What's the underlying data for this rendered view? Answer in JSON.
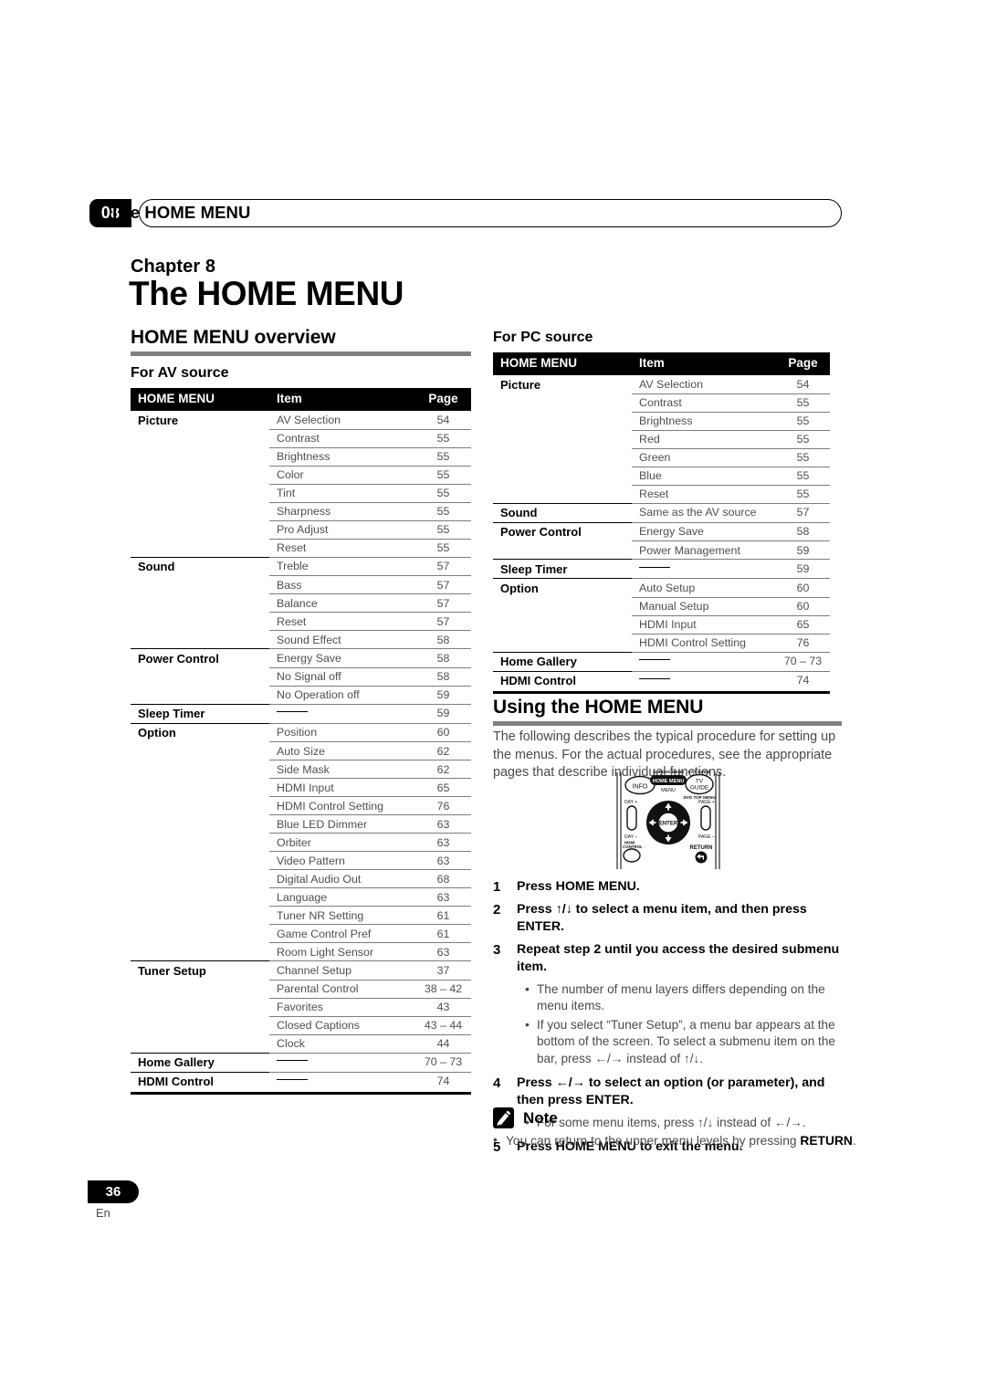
{
  "header": {
    "chapter_number": "08",
    "running_title": "The HOME MENU"
  },
  "chapter": {
    "label": "Chapter 8",
    "title": "The HOME MENU"
  },
  "sections": {
    "overview_heading": "HOME MENU overview",
    "av_source_heading": "For AV source",
    "pc_source_heading": "For PC source",
    "using_heading": "Using the HOME MENU"
  },
  "table_columns": {
    "menu": "HOME MENU",
    "item": "Item",
    "page": "Page"
  },
  "av_table": [
    {
      "menu": "Picture",
      "rows": [
        {
          "item": "AV Selection",
          "page": "54"
        },
        {
          "item": "Contrast",
          "page": "55"
        },
        {
          "item": "Brightness",
          "page": "55"
        },
        {
          "item": "Color",
          "page": "55"
        },
        {
          "item": "Tint",
          "page": "55"
        },
        {
          "item": "Sharpness",
          "page": "55"
        },
        {
          "item": "Pro Adjust",
          "page": "55"
        },
        {
          "item": "Reset",
          "page": "55"
        }
      ]
    },
    {
      "menu": "Sound",
      "rows": [
        {
          "item": "Treble",
          "page": "57"
        },
        {
          "item": "Bass",
          "page": "57"
        },
        {
          "item": "Balance",
          "page": "57"
        },
        {
          "item": "Reset",
          "page": "57"
        },
        {
          "item": "Sound Effect",
          "page": "58"
        }
      ]
    },
    {
      "menu": "Power Control",
      "rows": [
        {
          "item": "Energy Save",
          "page": "58"
        },
        {
          "item": "No Signal off",
          "page": "58"
        },
        {
          "item": "No Operation off",
          "page": "59"
        }
      ]
    },
    {
      "menu": "Sleep Timer",
      "rows": [
        {
          "item": "",
          "dash": true,
          "page": "59"
        }
      ]
    },
    {
      "menu": "Option",
      "rows": [
        {
          "item": "Position",
          "page": "60"
        },
        {
          "item": "Auto Size",
          "page": "62"
        },
        {
          "item": "Side Mask",
          "page": "62"
        },
        {
          "item": "HDMI Input",
          "page": "65"
        },
        {
          "item": "HDMI Control Setting",
          "page": "76"
        },
        {
          "item": "Blue LED Dimmer",
          "page": "63"
        },
        {
          "item": "Orbiter",
          "page": "63"
        },
        {
          "item": "Video Pattern",
          "page": "63"
        },
        {
          "item": "Digital Audio Out",
          "page": "68"
        },
        {
          "item": "Language",
          "page": "63"
        },
        {
          "item": "Tuner NR Setting",
          "page": "61"
        },
        {
          "item": "Game Control Pref",
          "page": "61"
        },
        {
          "item": "Room Light Sensor",
          "page": "63"
        }
      ]
    },
    {
      "menu": "Tuner Setup",
      "rows": [
        {
          "item": "Channel Setup",
          "page": "37"
        },
        {
          "item": "Parental Control",
          "page": "38 – 42"
        },
        {
          "item": "Favorites",
          "page": "43"
        },
        {
          "item": "Closed Captions",
          "page": "43 – 44"
        },
        {
          "item": "Clock",
          "page": "44"
        }
      ]
    },
    {
      "menu": "Home Gallery",
      "rows": [
        {
          "item": "",
          "dash": true,
          "page": "70 – 73"
        }
      ]
    },
    {
      "menu": "HDMI Control",
      "rows": [
        {
          "item": "",
          "dash": true,
          "page": "74"
        }
      ]
    }
  ],
  "pc_table": [
    {
      "menu": "Picture",
      "rows": [
        {
          "item": "AV Selection",
          "page": "54"
        },
        {
          "item": "Contrast",
          "page": "55"
        },
        {
          "item": "Brightness",
          "page": "55"
        },
        {
          "item": "Red",
          "page": "55"
        },
        {
          "item": "Green",
          "page": "55"
        },
        {
          "item": "Blue",
          "page": "55"
        },
        {
          "item": "Reset",
          "page": "55"
        }
      ]
    },
    {
      "menu": "Sound",
      "rows": [
        {
          "item": "Same as the AV source",
          "page": "57"
        }
      ]
    },
    {
      "menu": "Power Control",
      "rows": [
        {
          "item": "Energy Save",
          "page": "58"
        },
        {
          "item": "Power Management",
          "page": "59"
        }
      ]
    },
    {
      "menu": "Sleep Timer",
      "rows": [
        {
          "item": "",
          "dash": true,
          "page": "59"
        }
      ]
    },
    {
      "menu": "Option",
      "rows": [
        {
          "item": "Auto Setup",
          "page": "60"
        },
        {
          "item": "Manual Setup",
          "page": "60"
        },
        {
          "item": "HDMI Input",
          "page": "65"
        },
        {
          "item": "HDMI Control Setting",
          "page": "76"
        }
      ]
    },
    {
      "menu": "Home Gallery",
      "rows": [
        {
          "item": "",
          "dash": true,
          "page": "70 – 73"
        }
      ]
    },
    {
      "menu": "HDMI Control",
      "rows": [
        {
          "item": "",
          "dash": true,
          "page": "74"
        }
      ]
    }
  ],
  "using": {
    "intro": "The following describes the typical procedure for setting up the menus. For the actual procedures, see the appropriate pages that describe individual functions.",
    "steps": [
      {
        "num": "1",
        "text": "Press HOME MENU."
      },
      {
        "num": "2",
        "text": "Press ↑/↓ to select a menu item, and then press ENTER."
      },
      {
        "num": "3",
        "text": "Repeat step 2 until you access the desired submenu item.",
        "bullets": [
          "The number of menu layers differs depending on the menu items.",
          "If you select “Tuner Setup”, a menu bar appears at the bottom of the screen. To select a submenu item on the bar, press ←/→ instead of ↑/↓."
        ]
      },
      {
        "num": "4",
        "text": "Press ←/→ to select an option (or parameter), and then press ENTER.",
        "bullets": [
          "For some menu items, press ↑/↓ instead of ←/→."
        ]
      },
      {
        "num": "5",
        "text": "Press HOME MENU to exit the menu."
      }
    ]
  },
  "note": {
    "title": "Note",
    "text_before": "You can return to the upper menu levels by pressing ",
    "emphasis": "RETURN",
    "text_after": "."
  },
  "remote": {
    "info": "INFO",
    "sat_dvd_menu": "SAT/DVD MENU",
    "home_menu": "HOME MENU",
    "menu": "MENU",
    "sat_guide": "SAT GUIDE",
    "tv_guide": "TV GUIDE",
    "dvd_top_menu": "DVD TOP MENU",
    "day_plus": "DAY +",
    "day_minus": "DAY –",
    "page_plus": "PAGE +",
    "page_minus": "PAGE –",
    "hdmi_control": "HDMI CONTROL",
    "enter": "ENTER",
    "return": "RETURN"
  },
  "footer": {
    "page_number": "36",
    "language": "En"
  }
}
